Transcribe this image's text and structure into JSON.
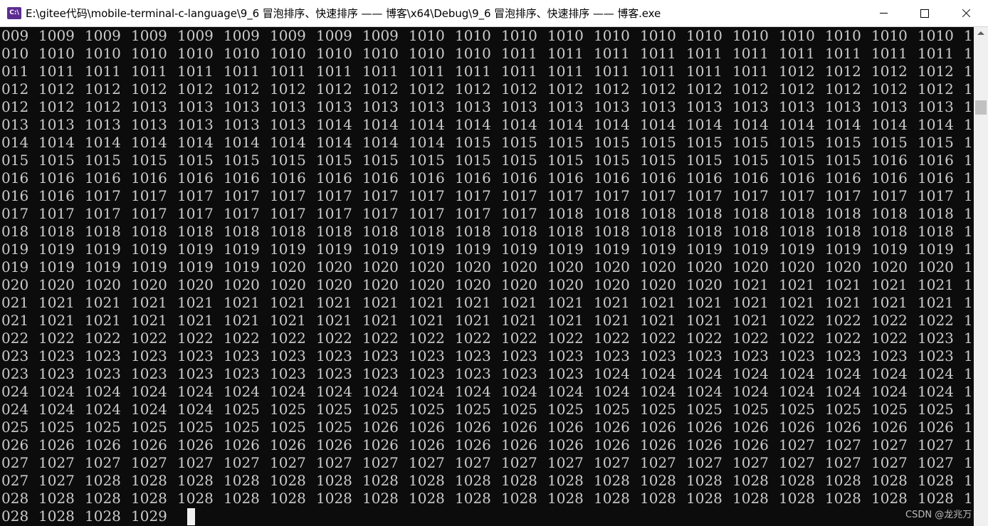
{
  "window": {
    "title": "E:\\gitee代码\\mobile-terminal-c-language\\9_6 冒泡排序、快速排序 —— 博客\\x64\\Debug\\9_6 冒泡排序、快速排序 —— 博客.exe",
    "icon_label": "C:\\"
  },
  "console": {
    "lines": [
      "009 1009 1009 1009 1009 1009 1009 1009 1009 1010 1010 1010 1010 1010 1010 1010 1010 1010 1010 1010 1010 1",
      "010 1010 1010 1010 1010 1010 1010 1010 1010 1010 1010 1011 1011 1011 1011 1011 1011 1011 1011 1011 1011 1",
      "011 1011 1011 1011 1011 1011 1011 1011 1011 1011 1011 1011 1011 1011 1011 1011 1011 1012 1012 1012 1012 1",
      "012 1012 1012 1012 1012 1012 1012 1012 1012 1012 1012 1012 1012 1012 1012 1012 1012 1012 1012 1012 1012 1",
      "012 1012 1012 1013 1013 1013 1013 1013 1013 1013 1013 1013 1013 1013 1013 1013 1013 1013 1013 1013 1013 1",
      "013 1013 1013 1013 1013 1013 1013 1014 1014 1014 1014 1014 1014 1014 1014 1014 1014 1014 1014 1014 1014 1",
      "014 1014 1014 1014 1014 1014 1014 1014 1014 1014 1015 1015 1015 1015 1015 1015 1015 1015 1015 1015 1015 1",
      "015 1015 1015 1015 1015 1015 1015 1015 1015 1015 1015 1015 1015 1015 1015 1015 1015 1015 1015 1016 1016 1",
      "016 1016 1016 1016 1016 1016 1016 1016 1016 1016 1016 1016 1016 1016 1016 1016 1016 1016 1016 1016 1016 1",
      "016 1016 1017 1017 1017 1017 1017 1017 1017 1017 1017 1017 1017 1017 1017 1017 1017 1017 1017 1017 1017 1",
      "017 1017 1017 1017 1017 1017 1017 1017 1017 1017 1017 1017 1018 1018 1018 1018 1018 1018 1018 1018 1018 1",
      "018 1018 1018 1018 1018 1018 1018 1018 1018 1018 1018 1018 1018 1018 1018 1018 1018 1018 1018 1018 1018 1",
      "019 1019 1019 1019 1019 1019 1019 1019 1019 1019 1019 1019 1019 1019 1019 1019 1019 1019 1019 1019 1019 1",
      "019 1019 1019 1019 1019 1019 1020 1020 1020 1020 1020 1020 1020 1020 1020 1020 1020 1020 1020 1020 1020 1",
      "020 1020 1020 1020 1020 1020 1020 1020 1020 1020 1020 1020 1020 1020 1020 1020 1021 1021 1021 1021 1021 1",
      "021 1021 1021 1021 1021 1021 1021 1021 1021 1021 1021 1021 1021 1021 1021 1021 1021 1021 1021 1021 1021 1",
      "021 1021 1021 1021 1021 1021 1021 1021 1021 1021 1021 1021 1021 1021 1021 1021 1021 1022 1022 1022 1022 1",
      "022 1022 1022 1022 1022 1022 1022 1022 1022 1022 1022 1022 1022 1022 1022 1022 1022 1022 1022 1022 1023 1",
      "023 1023 1023 1023 1023 1023 1023 1023 1023 1023 1023 1023 1023 1023 1023 1023 1023 1023 1023 1023 1023 1",
      "023 1023 1023 1023 1023 1023 1023 1023 1023 1023 1023 1023 1023 1024 1024 1024 1024 1024 1024 1024 1024 1",
      "024 1024 1024 1024 1024 1024 1024 1024 1024 1024 1024 1024 1024 1024 1024 1024 1024 1024 1024 1024 1024 1",
      "024 1024 1024 1024 1024 1025 1025 1025 1025 1025 1025 1025 1025 1025 1025 1025 1025 1025 1025 1025 1025 1",
      "025 1025 1025 1025 1025 1025 1025 1025 1026 1026 1026 1026 1026 1026 1026 1026 1026 1026 1026 1026 1026 1",
      "026 1026 1026 1026 1026 1026 1026 1026 1026 1026 1026 1026 1026 1026 1026 1026 1026 1027 1027 1027 1027 1",
      "027 1027 1027 1027 1027 1027 1027 1027 1027 1027 1027 1027 1027 1027 1027 1027 1027 1027 1027 1027 1027 1",
      "027 1027 1028 1028 1028 1028 1028 1028 1028 1028 1028 1028 1028 1028 1028 1028 1028 1028 1028 1028 1028 1",
      "028 1028 1028 1028 1028 1028 1028 1028 1028 1028 1028 1028 1028 1028 1028 1028 1028 1028 1028 1028 1028 1",
      "028 1028 1028 1029"
    ]
  },
  "watermark": "CSDN @龙兆万"
}
